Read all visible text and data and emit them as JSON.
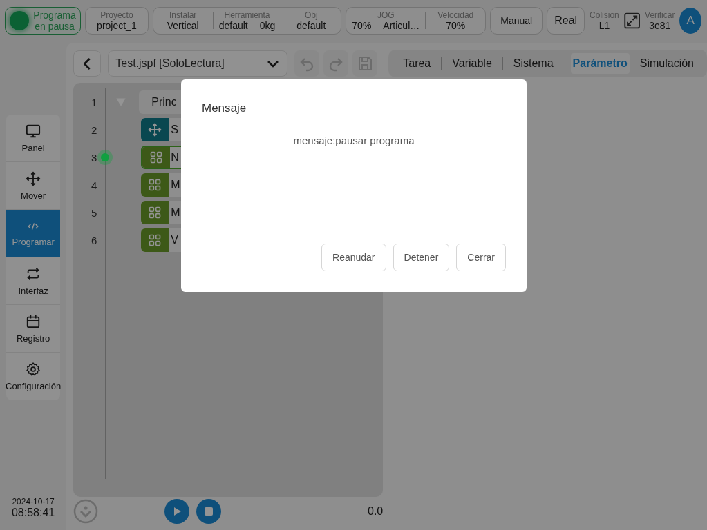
{
  "top_bar": {
    "status": {
      "label": "Programa en pausa",
      "running": false
    },
    "project": {
      "label": "Proyecto",
      "value": "project_1"
    },
    "setup_group": [
      {
        "label": "Instalar",
        "values": [
          "Vertical"
        ]
      },
      {
        "label": "Herramienta",
        "values": [
          "default",
          "0kg"
        ]
      },
      {
        "label": "Obj",
        "values": [
          "default"
        ]
      }
    ],
    "motion_group": [
      {
        "label": "JOG",
        "values": [
          "70%",
          "Articul…"
        ]
      },
      {
        "label": "Velocidad",
        "values": [
          "70%"
        ]
      }
    ],
    "mode_buttons": [
      "Manual",
      "Real"
    ],
    "collision": {
      "label": "Colisión",
      "value": "L1"
    },
    "verify": {
      "label": "Verificar",
      "value": "3e81"
    },
    "avatar": "A"
  },
  "nav": [
    {
      "label": "Panel",
      "selected": false
    },
    {
      "label": "Mover",
      "selected": false
    },
    {
      "label": "Programar",
      "selected": true
    },
    {
      "label": "Interfaz",
      "selected": false
    },
    {
      "label": "Registro",
      "selected": false
    },
    {
      "label": "Configuración",
      "selected": false
    }
  ],
  "clock": {
    "date": "2024-10-17",
    "time": "08:58:41"
  },
  "toolbar": {
    "file": "Test.jspf [SoloLectura]"
  },
  "tabs": [
    {
      "label": "Tarea",
      "selected": false
    },
    {
      "label": "Variable",
      "selected": false
    },
    {
      "label": "Sistema",
      "selected": false
    },
    {
      "label": "Parámetro",
      "selected": true
    },
    {
      "label": "Simulación",
      "selected": false
    }
  ],
  "program_lines": [
    {
      "number": "1",
      "kind": "folder",
      "text": "Princ",
      "expanded": true,
      "selected": false,
      "current": false
    },
    {
      "number": "2",
      "kind": "move",
      "text": "S",
      "selected": false,
      "current": false
    },
    {
      "number": "3",
      "kind": "block",
      "text": "N",
      "selected": true,
      "current": true
    },
    {
      "number": "4",
      "kind": "block",
      "text": "M",
      "selected": false,
      "current": false
    },
    {
      "number": "5",
      "kind": "block",
      "text": "M",
      "selected": false,
      "current": false
    },
    {
      "number": "6",
      "kind": "block",
      "text": "V",
      "selected": false,
      "current": false
    }
  ],
  "footer": {
    "speed_reading": "0.0"
  },
  "dialog": {
    "title": "Mensaje",
    "message": "mensaje:pausar programa",
    "buttons": [
      "Reanudar",
      "Detener",
      "Cerrar"
    ]
  }
}
